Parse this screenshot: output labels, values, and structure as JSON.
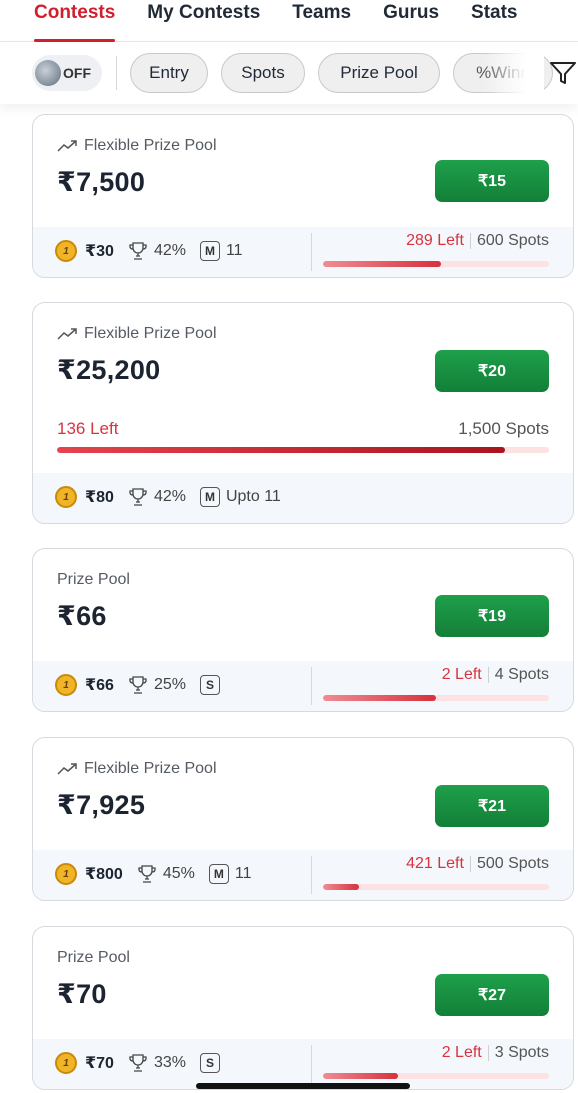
{
  "tabs": [
    {
      "label": "Contests",
      "active": true
    },
    {
      "label": "My Contests"
    },
    {
      "label": "Teams"
    },
    {
      "label": "Gurus"
    },
    {
      "label": "Stats"
    }
  ],
  "filters": {
    "toggle_label": "OFF",
    "chips": [
      "Entry",
      "Spots",
      "Prize Pool",
      "%Winn"
    ]
  },
  "contests": [
    {
      "pool_label": "Flexible Prize Pool",
      "flexible": true,
      "amount": "₹7,500",
      "entry": "₹15",
      "first": "₹30",
      "win": "42%",
      "badge": "M",
      "max_entries": "11",
      "left": "289 Left",
      "spots": "600 Spots",
      "fill_fraction": 0.52
    },
    {
      "pool_label": "Flexible Prize Pool",
      "flexible": true,
      "amount": "₹25,200",
      "entry": "₹20",
      "first": "₹80",
      "win": "42%",
      "badge": "M",
      "max_entries": "Upto 11",
      "left": "136 Left",
      "spots": "1,500 Spots",
      "fill_fraction": 0.91
    },
    {
      "pool_label": "Prize Pool",
      "flexible": false,
      "amount": "₹66",
      "entry": "₹19",
      "first": "₹66",
      "win": "25%",
      "badge": "S",
      "max_entries": "",
      "left": "2 Left",
      "spots": "4 Spots",
      "fill_fraction": 0.5
    },
    {
      "pool_label": "Flexible Prize Pool",
      "flexible": true,
      "amount": "₹7,925",
      "entry": "₹21",
      "first": "₹800",
      "win": "45%",
      "badge": "M",
      "max_entries": "11",
      "left": "421 Left",
      "spots": "500 Spots",
      "fill_fraction": 0.16
    },
    {
      "pool_label": "Prize Pool",
      "flexible": false,
      "amount": "₹70",
      "entry": "₹27",
      "first": "₹70",
      "win": "33%",
      "badge": "S",
      "max_entries": "",
      "left": "2 Left",
      "spots": "3 Spots",
      "fill_fraction": 0.33
    }
  ],
  "colors": {
    "accent": "#d11f2e",
    "join_button": "#1a9144",
    "spots_left": "#d8343f"
  }
}
